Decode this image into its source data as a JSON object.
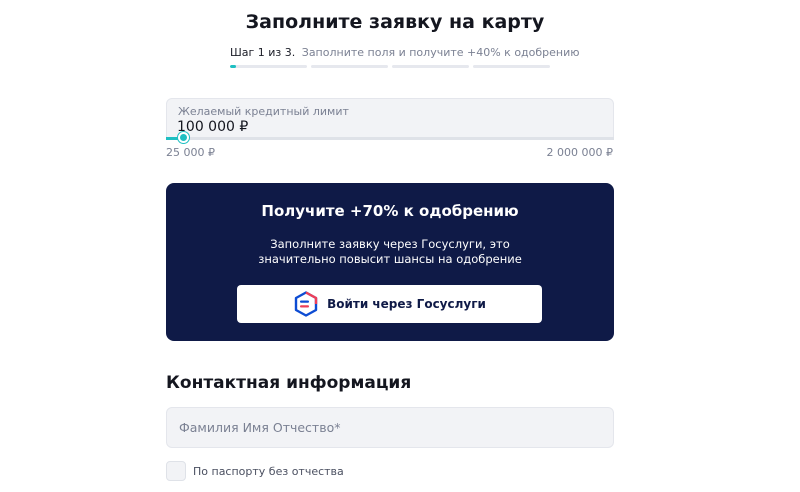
{
  "page": {
    "title": "Заполните заявку на карту"
  },
  "steps": {
    "current": "Шаг 1 из 3.",
    "hint": "Заполните поля и получите +40% к одобрению",
    "progress_segments": [
      0.08,
      0,
      0,
      0
    ]
  },
  "limit": {
    "label": "Желаемый кредитный лимит",
    "value": "100 000 ₽",
    "min_label": "25 000 ₽",
    "max_label": "2 000 000 ₽",
    "slider_fraction": 0.04
  },
  "promo": {
    "title": "Получите +70% к одобрению",
    "text": "Заполните заявку через Госуслуги, это значительно повысит шансы на одобрение",
    "button_label": "Войти через Госуслуги"
  },
  "contact": {
    "section_title": "Контактная информация",
    "name_placeholder": "Фамилия Имя Отчество*",
    "no_patronymic_label": "По паспорту без отчества"
  },
  "colors": {
    "accent": "#1ebfc2",
    "promo_bg": "#0f1a47",
    "field_bg": "#f2f3f6"
  }
}
